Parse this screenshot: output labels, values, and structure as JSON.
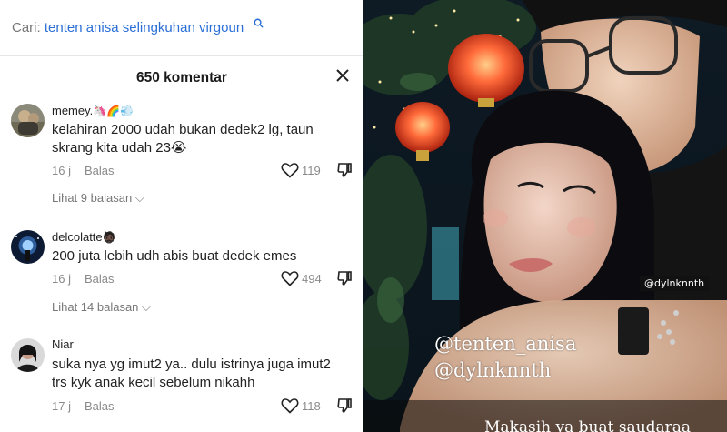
{
  "search": {
    "prefix": "Cari:",
    "query": "tenten anisa selingkuhan virgoun"
  },
  "comments_header": {
    "title": "650 komentar"
  },
  "comments": [
    {
      "username": "memey.",
      "username_emoji": "🦄🌈💨",
      "text": "kelahiran 2000 udah bukan dedek2 lg, taun skrang kita udah 23😭",
      "time": "16 j",
      "reply_label": "Balas",
      "likes": "119",
      "replies_label": "Lihat 9 balasan"
    },
    {
      "username": "delcolatte",
      "username_emoji": "🧔🏿",
      "text": "200 juta lebih udh abis buat dedek emes",
      "time": "16 j",
      "reply_label": "Balas",
      "likes": "494",
      "replies_label": "Lihat 14 balasan"
    },
    {
      "username": "Niar",
      "username_emoji": "",
      "text": "suka nya yg imut2 ya.. dulu istrinya juga imut2 trs kyk anak kecil sebelum nikahh",
      "time": "17 j",
      "reply_label": "Balas",
      "likes": "118",
      "replies_label": ""
    }
  ],
  "photo": {
    "tag_small": "@dylnknnth",
    "tag_1": "@tenten_anisa",
    "tag_2": "@dylnknnth",
    "caption": "Makasih ya buat saudaraa"
  },
  "colors": {
    "link_blue": "#2b6fd6",
    "muted": "#8a8a8a",
    "text": "#222222"
  }
}
